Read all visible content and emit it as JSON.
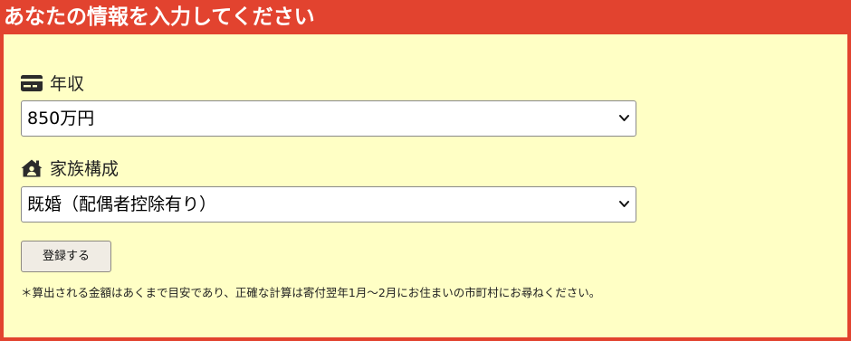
{
  "header": {
    "title": "あなたの情報を入力してください"
  },
  "income": {
    "label": "年収",
    "icon": "credit-card-icon",
    "selected": "850万円"
  },
  "family": {
    "label": "家族構成",
    "icon": "house-user-icon",
    "selected": "既婚（配偶者控除有り）"
  },
  "submit": {
    "label": "登録する"
  },
  "note": {
    "text": "＊算出される金額はあくまで目安であり、正確な計算は寄付翌年1月〜2月にお住まいの市町村にお尋ねください。"
  },
  "colors": {
    "header_bg": "#e2432f",
    "panel_bg": "#ffffc5",
    "header_text": "#ffffff"
  }
}
